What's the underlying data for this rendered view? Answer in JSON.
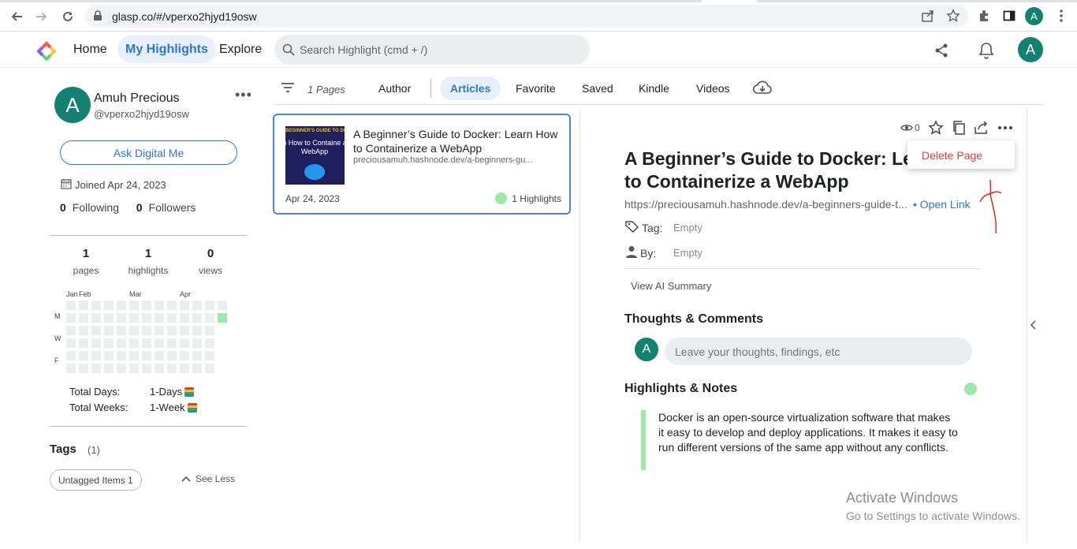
{
  "browser": {
    "url": "glasp.co/#/vperxo2hjyd19osw",
    "profile_initial": "A"
  },
  "header": {
    "nav": [
      "Home",
      "My Highlights",
      "Explore"
    ],
    "active_nav": "My Highlights",
    "search_placeholder": "Search Highlight (cmd + /)",
    "avatar_initial": "A"
  },
  "profile": {
    "avatar_initial": "A",
    "name": "Amuh Precious",
    "handle": "@vperxo2hjyd19osw",
    "ask_button": "Ask Digital Me",
    "joined": "Joined Apr 24, 2023",
    "following_count": "0",
    "following_label": "Following",
    "followers_count": "0",
    "followers_label": "Followers"
  },
  "stats": [
    {
      "value": "1",
      "label": "pages"
    },
    {
      "value": "1",
      "label": "highlights"
    },
    {
      "value": "0",
      "label": "views"
    }
  ],
  "heatmap": {
    "months": [
      "Jan",
      "Feb",
      "Mar",
      "Apr"
    ],
    "weekdays": [
      "M",
      "W",
      "F"
    ]
  },
  "totals": {
    "days_label": "Total Days:",
    "days_value": "1-Days",
    "weeks_label": "Total Weeks:",
    "weeks_value": "1-Week"
  },
  "tags": {
    "title": "Tags",
    "count": "(1)",
    "chip": "Untagged Items 1",
    "see_less": "See Less"
  },
  "filters": {
    "pages_count": "1 Pages",
    "tabs": [
      "Author",
      "Articles",
      "Favorite",
      "Saved",
      "Kindle",
      "Videos"
    ],
    "active": "Articles"
  },
  "card": {
    "thumb_line1": "BEGINNER'S GUIDE TO DOCKER",
    "thumb_line2": "n How to Containe a WebApp",
    "title": "A Beginner’s Guide to Docker: Learn How to Containerize a WebApp",
    "url": "preciousamuh.hashnode.dev/a-beginners-gu...",
    "date": "Apr 24, 2023",
    "highlights": "1 Highlights"
  },
  "detail": {
    "views": "0",
    "menu_item": "Delete Page",
    "title_line1": "A Beginner’s Guide to Docker: Lea",
    "title_line2": "to Containerize a WebApp",
    "url": "https://preciousamuh.hashnode.dev/a-beginners-guide-t...",
    "open_link": "• Open Link",
    "tag_label": "Tag:",
    "tag_value": "Empty",
    "by_label": "By:",
    "by_value": "Empty",
    "ai_summary": "View AI Summary",
    "thoughts_title": "Thoughts & Comments",
    "comment_avatar": "A",
    "comment_placeholder": "Leave your thoughts, findings, etc",
    "highlights_title": "Highlights & Notes",
    "highlight_text": "Docker is an open-source virtualization software that makes it easy to develop and deploy applications. It makes it easy to run different versions of the same app without any conflicts."
  },
  "watermark": {
    "line1": "Activate Windows",
    "line2": "Go to Settings to activate Windows."
  },
  "colors": {
    "brand_teal": "#128170",
    "accent_blue": "#2e75d6",
    "highlight_green": "#9be9a8",
    "danger_red": "#e53935"
  }
}
